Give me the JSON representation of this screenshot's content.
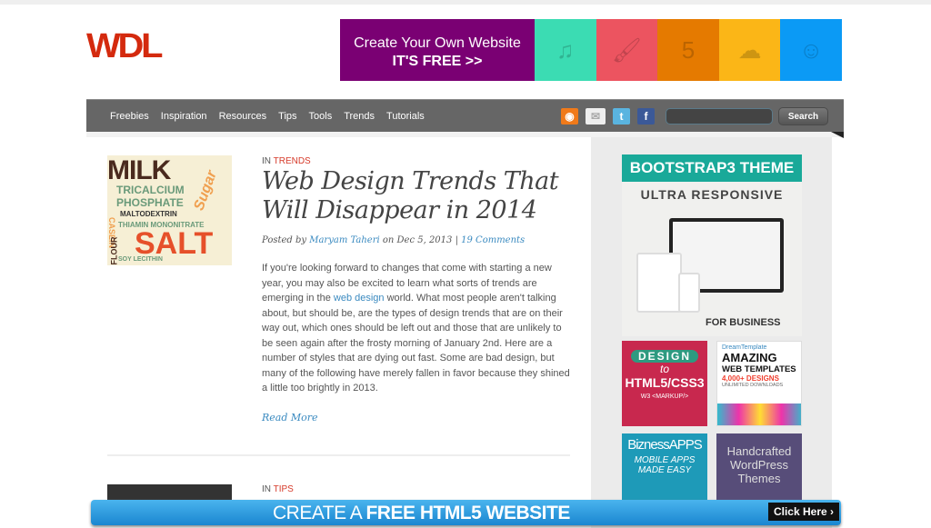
{
  "logo": "WDL",
  "banner": {
    "line1": "Create Your Own Website",
    "line2": "IT'S FREE >>",
    "tiles": [
      {
        "color": "#3bdcb3",
        "icon": "music-notes-icon",
        "glyph": "♫"
      },
      {
        "color": "#ec5460",
        "icon": "paint-brush-icon",
        "glyph": "🖌"
      },
      {
        "color": "#e57a00",
        "icon": "html5-icon",
        "glyph": "5"
      },
      {
        "color": "#fbb617",
        "icon": "cloud-icon",
        "glyph": "☁"
      },
      {
        "color": "#0b9af5",
        "icon": "ninja-icon",
        "glyph": "☺"
      }
    ]
  },
  "nav": {
    "items": [
      "Freebies",
      "Inspiration",
      "Resources",
      "Tips",
      "Tools",
      "Trends",
      "Tutorials"
    ],
    "search_label": "Search",
    "search_value": ""
  },
  "post": {
    "category_prefix": "IN",
    "category": "TRENDS",
    "title": "Web Design Trends That Will Disappear in 2014",
    "posted_by": "Posted by",
    "author": "Maryam Taheri",
    "on": "on Dec 5, 2013 |",
    "comments": "19 Comments",
    "body_before": "If you're looking forward to changes that come with starting a new year, you may also be excited to learn what sorts of trends are emerging in the ",
    "body_link": "web design",
    "body_after": " world. What most people aren't talking about, but should be, are the types of design trends that are on their way out, which ones should be left out and those that are unlikely to be seen again after the frosty morning of January 2nd. Here are a number of styles that are dying out fast. Some are bad design, but many of the following have merely fallen in favor because they shined a little too brightly in 2013.",
    "read_more": "Read More",
    "thumb_words": [
      "MILK",
      "TRICALCIUM",
      "PHOSPHATE",
      "MALTODEXTRIN",
      "THIAMIN MONONITRATE",
      "SALT",
      "CASEIN",
      "FLOUR",
      "Sugar",
      "SOY LECITHIN"
    ]
  },
  "post2": {
    "category_prefix": "IN",
    "category": "TIPS"
  },
  "sidebar": {
    "ad1": {
      "header": "BOOTSTRAP3 THEME",
      "sub": "ULTRA RESPONSIVE",
      "footer": "FOR BUSINESS"
    },
    "ad2": {
      "l1": "DESIGN",
      "l2": "to",
      "l3": "HTML5/CSS3",
      "l4": "W3 <MARKUP/>"
    },
    "ad3": {
      "brand": "DreamTemplate",
      "l1": "AMAZING",
      "l2": "WEB TEMPLATES",
      "l3": "4,000+ DESIGNS",
      "l4": "UNLIMITED DOWNLOADS"
    },
    "ad4": {
      "brand": "BiznessAPPS",
      "l1": "MOBILE APPS",
      "l2": "MADE EASY"
    },
    "ad5": {
      "text": "Handcrafted WordPress Themes"
    }
  },
  "bottom": {
    "text_light": "CREATE A ",
    "text_bold": "FREE HTML5 WEBSITE",
    "button": "Click Here"
  }
}
